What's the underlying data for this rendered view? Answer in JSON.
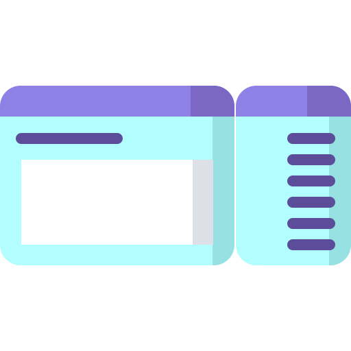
{
  "icon": {
    "name": "ticket-icon",
    "parts": {
      "main_section": "ticket-main-section",
      "stub_section": "ticket-stub-section"
    },
    "stub_line_count": 6
  },
  "colors": {
    "header": "#8f80e6",
    "header_shade": "#7a68c4",
    "body": "#b2fefe",
    "body_shade": "#98e1e3",
    "line": "#5b4d99",
    "panel": "#ffffff",
    "panel_shade": "#dde0e7"
  }
}
